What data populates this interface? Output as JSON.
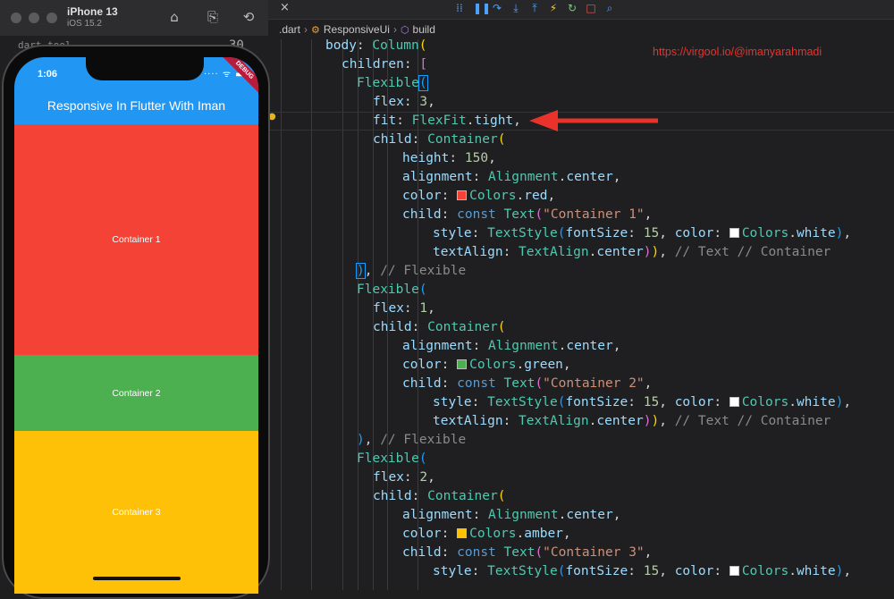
{
  "simulator": {
    "device_name": "iPhone 13",
    "os_version": "iOS 15.2",
    "behind_line_number": "30",
    "behind_folder": "dart_tool",
    "status_time": "1:06",
    "status_icons": "···· ᯤ ▬",
    "debug_banner": "DEBUG",
    "appbar_title": "Responsive In Flutter With Iman",
    "containers": [
      {
        "label": "Container 1",
        "color": "#f44336"
      },
      {
        "label": "Container 2",
        "color": "#4caf50"
      },
      {
        "label": "Container 3",
        "color": "#ffc107"
      }
    ],
    "buttons": {
      "home": "⌂",
      "screenshot": "⎘",
      "rotate": "⟲"
    }
  },
  "editor": {
    "close_tab": "×",
    "breadcrumb": [
      ".dart",
      "ResponsiveUi",
      "build"
    ],
    "debug_toolbar": [
      "⁞⁞",
      "❚❚",
      "↷",
      "⤓",
      "⤒",
      "⚡",
      "↻",
      "□",
      "⌕"
    ],
    "url_annotation": "https://virgool.io/@imanyarahmadi",
    "arrow_color": "#e8322a"
  }
}
